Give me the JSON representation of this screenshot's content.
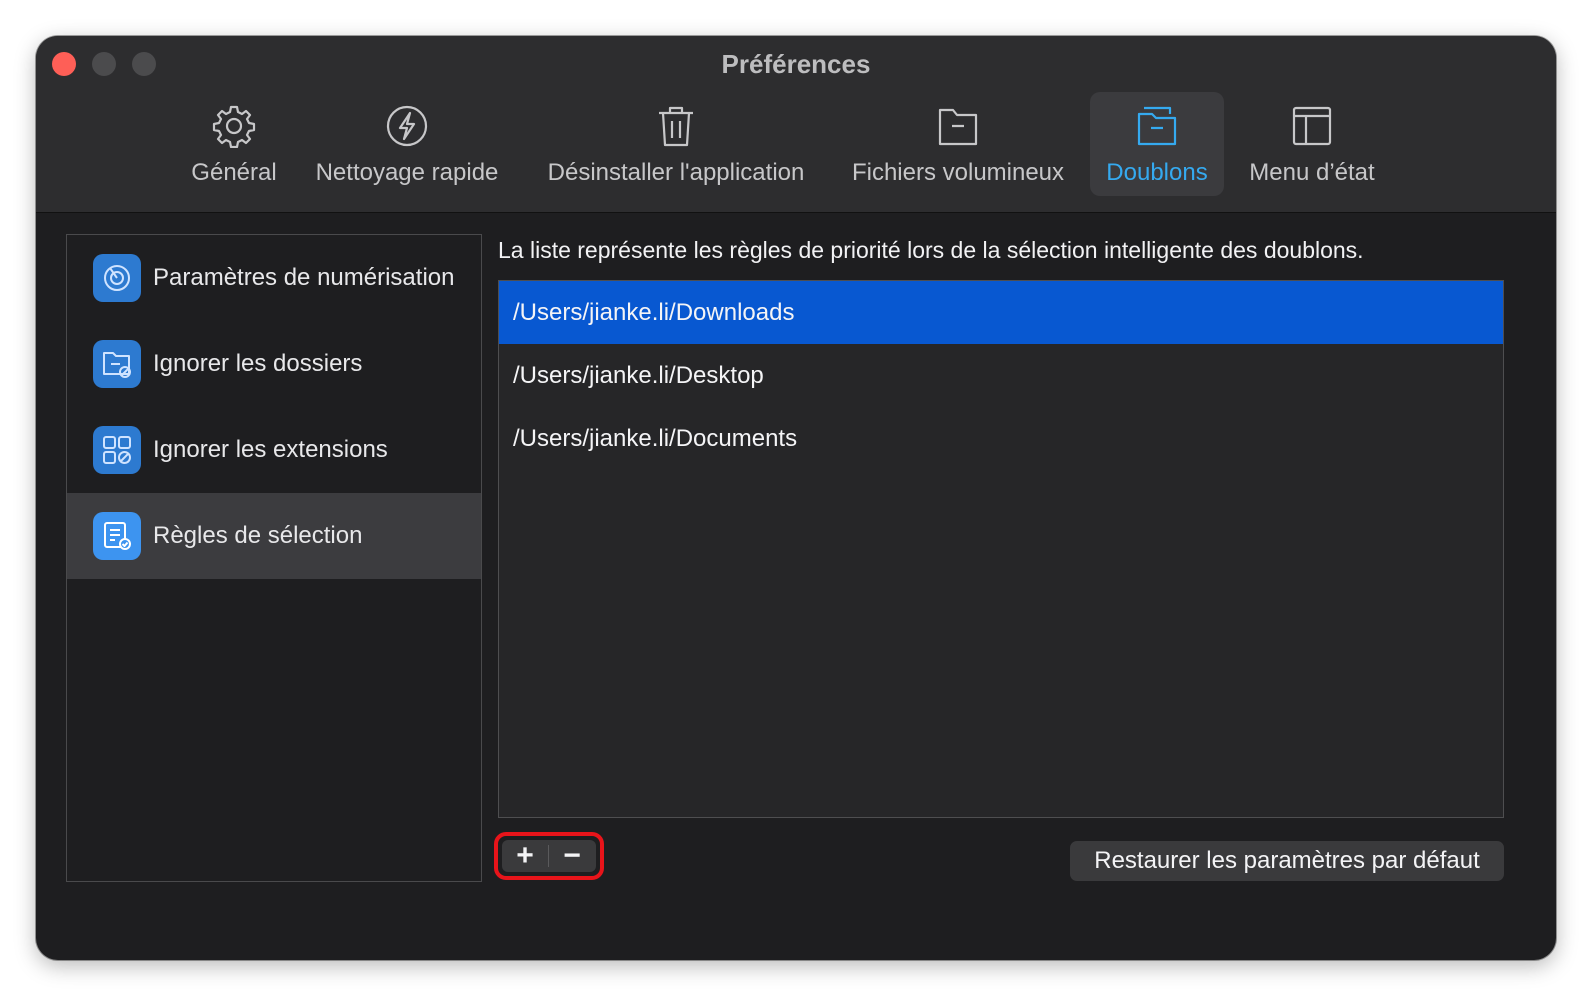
{
  "window": {
    "title": "Préférences"
  },
  "toolbar": {
    "items": [
      {
        "label": "Général",
        "icon": "gear-icon"
      },
      {
        "label": "Nettoyage rapide",
        "icon": "lightning-icon"
      },
      {
        "label": "Désinstaller l'application",
        "icon": "trash-icon"
      },
      {
        "label": "Fichiers volumineux",
        "icon": "large-file-icon"
      },
      {
        "label": "Doublons",
        "icon": "duplicate-folder-icon",
        "active": true
      },
      {
        "label": "Menu d’état",
        "icon": "menu-layout-icon"
      }
    ]
  },
  "sidebar": {
    "items": [
      {
        "label": "Paramètres de numérisation",
        "icon": "scan-radar-icon"
      },
      {
        "label": "Ignorer les dossiers",
        "icon": "ignore-folder-icon"
      },
      {
        "label": "Ignorer les extensions",
        "icon": "ignore-extensions-icon"
      },
      {
        "label": "Règles de sélection",
        "icon": "selection-rules-icon",
        "active": true
      }
    ]
  },
  "main": {
    "description": "La liste représente les règles de priorité lors de la sélection intelligente des doublons.",
    "rules": [
      {
        "path": "/Users/jianke.li/Downloads",
        "selected": true
      },
      {
        "path": "/Users/jianke.li/Desktop"
      },
      {
        "path": "/Users/jianke.li/Documents"
      }
    ],
    "add_label": "+",
    "remove_label": "−",
    "restore_label": "Restaurer les paramètres par défaut"
  },
  "colors": {
    "accent": "#35aaf0",
    "selection": "#0858d1",
    "highlight": "#e8141a",
    "close": "#fe5f57"
  }
}
